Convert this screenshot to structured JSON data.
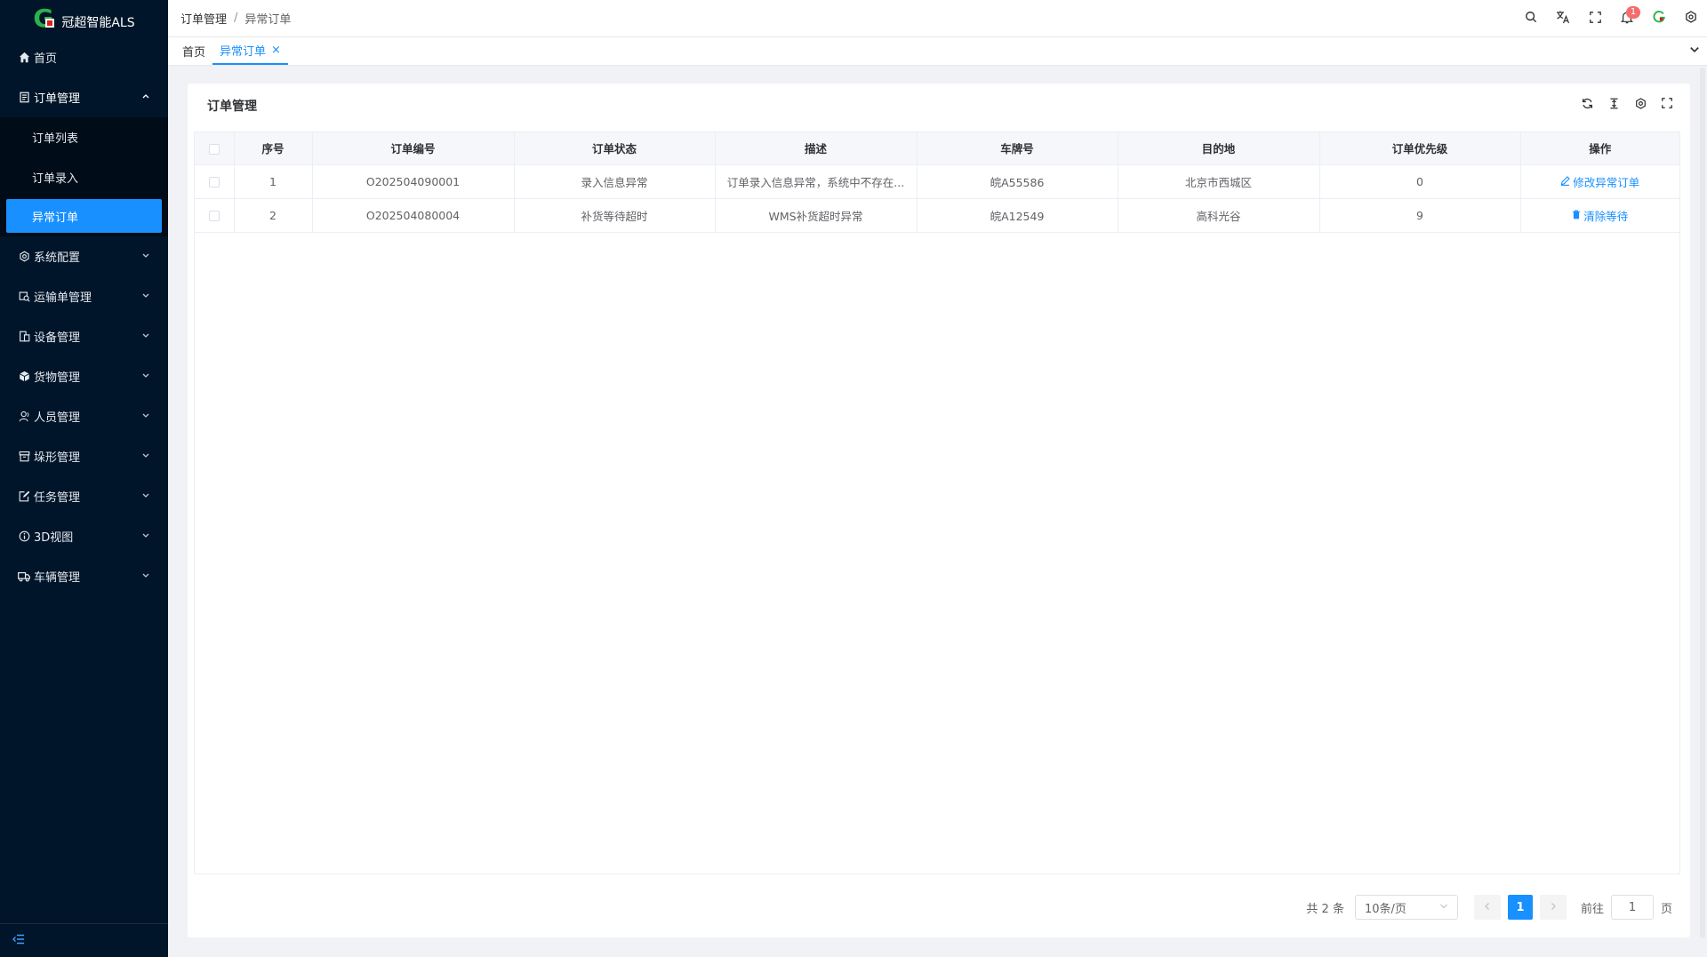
{
  "app": {
    "name": "冠超智能ALS",
    "logo_letter": "G"
  },
  "sidebar": {
    "items": [
      {
        "label": "首页",
        "icon": "home-icon"
      },
      {
        "label": "订单管理",
        "icon": "document-icon",
        "open": true,
        "children": [
          {
            "label": "订单列表"
          },
          {
            "label": "订单录入"
          },
          {
            "label": "异常订单",
            "active": true
          }
        ]
      },
      {
        "label": "系统配置",
        "icon": "gear-icon"
      },
      {
        "label": "运输单管理",
        "icon": "transport-icon"
      },
      {
        "label": "设备管理",
        "icon": "device-icon"
      },
      {
        "label": "货物管理",
        "icon": "cube-icon"
      },
      {
        "label": "人员管理",
        "icon": "user-icon"
      },
      {
        "label": "垛形管理",
        "icon": "box-icon"
      },
      {
        "label": "任务管理",
        "icon": "task-icon"
      },
      {
        "label": "3D视图",
        "icon": "info-icon"
      },
      {
        "label": "车辆管理",
        "icon": "truck-icon"
      }
    ]
  },
  "header": {
    "breadcrumb": [
      "订单管理",
      "异常订单"
    ],
    "separator": "/",
    "notification_count": "1",
    "tools": [
      "search-icon",
      "translate-icon",
      "fullscreen-icon",
      "bell-icon",
      "brand-g-icon",
      "settings-icon"
    ]
  },
  "tabs": [
    {
      "label": "首页"
    },
    {
      "label": "异常订单",
      "active": true,
      "close": "×"
    }
  ],
  "card": {
    "title": "订单管理",
    "tools": [
      "refresh-icon",
      "column-height-icon",
      "settings-icon",
      "fullscreen-icon"
    ]
  },
  "table": {
    "columns": [
      "",
      "序号",
      "订单编号",
      "订单状态",
      "描述",
      "车牌号",
      "目的地",
      "订单优先级",
      "操作"
    ],
    "rows": [
      {
        "seq": "1",
        "order_no": "O202504090001",
        "status": "录入信息异常",
        "desc": "订单录入信息异常，系统中不存在...",
        "plate": "皖A55586",
        "dest": "北京市西城区",
        "priority": "0",
        "action": "修改异常订单",
        "action_icon": "edit-icon"
      },
      {
        "seq": "2",
        "order_no": "O202504080004",
        "status": "补货等待超时",
        "desc": "WMS补货超时异常",
        "plate": "皖A12549",
        "dest": "高科光谷",
        "priority": "9",
        "action": "清除等待",
        "action_icon": "trash-icon"
      }
    ]
  },
  "pagination": {
    "total": "共 2 条",
    "page_size": "10条/页",
    "current": "1",
    "goto_label": "前往",
    "goto_value": "1",
    "page_unit": "页"
  },
  "colors": {
    "sidebar_bg": "#001529",
    "accent": "#1890ff",
    "badge": "#f56c6c",
    "brand_green": "#2cb24a"
  }
}
